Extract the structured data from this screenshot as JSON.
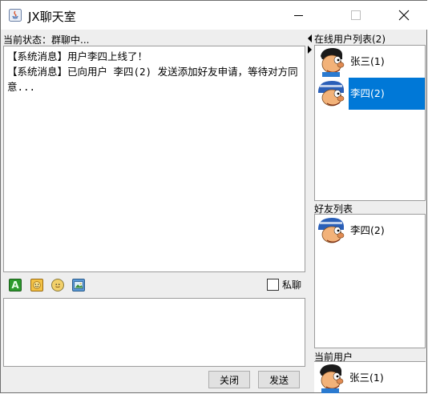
{
  "window": {
    "title": "JX聊天室"
  },
  "status": {
    "text": "当前状态：群聊中..."
  },
  "chat": {
    "messages": [
      "【系统消息】用户李四上线了！",
      "【系统消息】已向用户 李四(2) 发送添加好友申请，等待对方同意..."
    ]
  },
  "toolbar": {
    "icons": [
      "font-icon",
      "emoji-icon",
      "shake-icon",
      "image-icon"
    ],
    "private_label": "私聊"
  },
  "buttons": {
    "close": "关闭",
    "send": "发送"
  },
  "online": {
    "title": "在线用户列表(2)",
    "users": [
      {
        "name": "张三(1)",
        "selected": false
      },
      {
        "name": "李四(2)",
        "selected": true
      }
    ]
  },
  "friends": {
    "title": "好友列表",
    "users": [
      {
        "name": "李四(2)"
      }
    ]
  },
  "current": {
    "title": "当前用户",
    "user": {
      "name": "张三(1)"
    }
  },
  "colors": {
    "selection": "#0078d7",
    "window_bg": "#eeeeee"
  }
}
